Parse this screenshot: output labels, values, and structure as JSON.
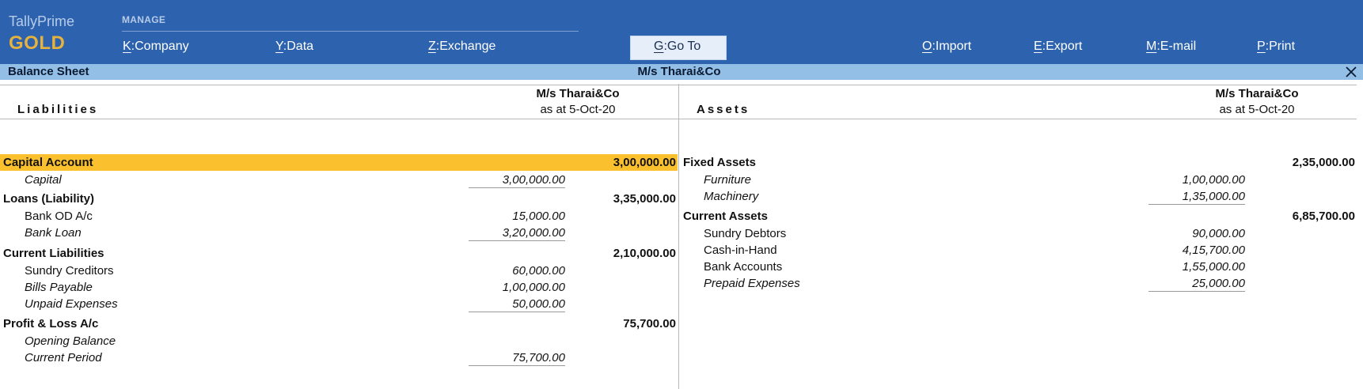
{
  "brand": {
    "name": "TallyPrime",
    "edition": "GOLD"
  },
  "manage": {
    "label": "MANAGE"
  },
  "menu": {
    "company": {
      "key": "K",
      "label": "Company"
    },
    "data": {
      "key": "Y",
      "label": "Data"
    },
    "exchange": {
      "key": "Z",
      "label": "Exchange"
    },
    "goto": {
      "key": "G",
      "label": "Go To"
    },
    "import": {
      "key": "O",
      "label": "Import"
    },
    "export": {
      "key": "E",
      "label": "Export"
    },
    "email": {
      "key": "M",
      "label": "E-mail"
    },
    "print": {
      "key": "P",
      "label": "Print"
    }
  },
  "titlebar": {
    "report": "Balance Sheet",
    "company": "M/s Tharai&Co",
    "close_glyph": "✕"
  },
  "liabilities": {
    "heading": "Liabilities",
    "company": "M/s Tharai&Co",
    "date": "as at 5-Oct-20",
    "groups": [
      {
        "name": "Capital Account",
        "amount": "3,00,000.00",
        "highlighted": true,
        "items": [
          {
            "name": "Capital",
            "amount": "3,00,000.00",
            "italic": true
          }
        ]
      },
      {
        "name": "Loans (Liability)",
        "amount": "3,35,000.00",
        "items": [
          {
            "name": "Bank OD A/c",
            "amount": "15,000.00",
            "italic": false
          },
          {
            "name": "Bank Loan",
            "amount": "3,20,000.00",
            "italic": true
          }
        ]
      },
      {
        "name": "Current Liabilities",
        "amount": "2,10,000.00",
        "items": [
          {
            "name": "Sundry Creditors",
            "amount": "60,000.00",
            "italic": false
          },
          {
            "name": "Bills Payable",
            "amount": "1,00,000.00",
            "italic": true
          },
          {
            "name": "Unpaid Expenses",
            "amount": "50,000.00",
            "italic": true
          }
        ]
      },
      {
        "name": "Profit & Loss A/c",
        "amount": "75,700.00",
        "items": [
          {
            "name": "Opening Balance",
            "amount": "",
            "italic": true
          },
          {
            "name": "Current Period",
            "amount": "75,700.00",
            "italic": true
          }
        ]
      }
    ]
  },
  "assets": {
    "heading": "Assets",
    "company": "M/s Tharai&Co",
    "date": "as at 5-Oct-20",
    "groups": [
      {
        "name": "Fixed Assets",
        "amount": "2,35,000.00",
        "items": [
          {
            "name": "Furniture",
            "amount": "1,00,000.00",
            "italic": true
          },
          {
            "name": "Machinery",
            "amount": "1,35,000.00",
            "italic": true
          }
        ]
      },
      {
        "name": "Current Assets",
        "amount": "6,85,700.00",
        "items": [
          {
            "name": "Sundry Debtors",
            "amount": "90,000.00",
            "italic": false
          },
          {
            "name": "Cash-in-Hand",
            "amount": "4,15,700.00",
            "italic": false
          },
          {
            "name": "Bank Accounts",
            "amount": "1,55,000.00",
            "italic": false
          },
          {
            "name": "Prepaid Expenses",
            "amount": "25,000.00",
            "italic": true
          }
        ]
      }
    ]
  },
  "colors": {
    "header_bg": "#2d63ae",
    "titlebar_bg": "#93bfe6",
    "highlight": "#fbc02d",
    "brand_gold": "#e5b13f"
  }
}
